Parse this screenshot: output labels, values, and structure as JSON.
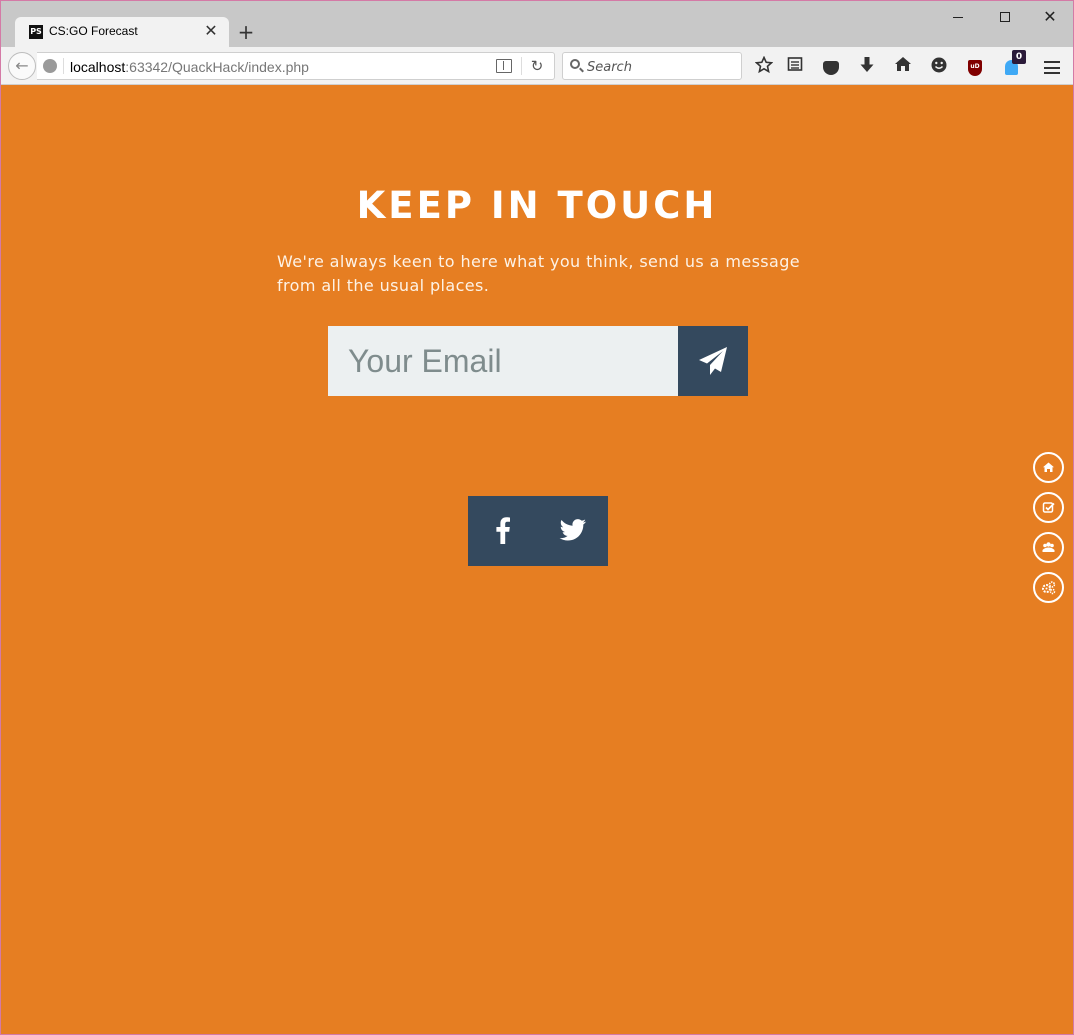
{
  "browser": {
    "tab_title": "CS:GO Forecast",
    "tab_favicon_text": "PS",
    "tab_close_glyph": "✕",
    "new_tab_glyph": "+",
    "window_close_glyph": "✕",
    "url_host": "localhost",
    "url_rest": ":63342/QuackHack/index.php",
    "search_placeholder": "Search",
    "notification_badge": "0",
    "back_glyph": "←",
    "reload_glyph": "↻",
    "toolbar_icons": [
      "star-icon",
      "reading-list-icon",
      "pocket-icon",
      "download-icon",
      "home-icon",
      "smiley-icon",
      "ublock-icon",
      "ghostery-icon",
      "menu-icon"
    ]
  },
  "page": {
    "heading": "KEEP IN TOUCH",
    "subtext": "We're always keen to here what you think, send us a message from all the usual places.",
    "email_placeholder": "Your Email",
    "send_icon": "paper-plane-icon",
    "social_icons": [
      "facebook-icon",
      "twitter-icon"
    ],
    "side_nav_icons": [
      "home-icon",
      "checkbox-icon",
      "users-icon",
      "cogs-icon"
    ]
  },
  "colors": {
    "page_background": "#e67e22",
    "dark_button": "#34495e",
    "input_background": "#ecf0f1",
    "placeholder_text": "#7f8c8d",
    "white": "#ffffff"
  }
}
